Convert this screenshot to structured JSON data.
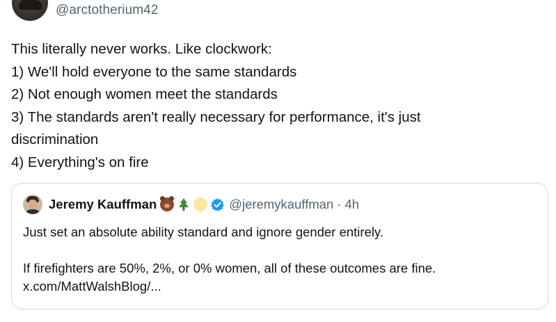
{
  "tweet": {
    "handle": "@arctotherium42",
    "lines": [
      "This literally never works. Like clockwork:",
      "1) We'll hold everyone to the same standards",
      "2) Not enough women meet the standards",
      "3) The standards aren't really necessary for performance, it's just",
      "discrimination",
      "4) Everything's on fire"
    ]
  },
  "quote": {
    "name": "Jeremy Kauffman",
    "badges": [
      "bear-emoji",
      "evergreen-tree-emoji",
      "sun-emoji",
      "verified-badge-icon"
    ],
    "handle": "@jeremykauffman",
    "separator": "·",
    "time": "4h",
    "body": [
      "Just set an absolute ability standard and ignore gender entirely.",
      "",
      "If firefighters are 50%, 2%, or 0% women, all of these outcomes are fine.",
      "x.com/MattWalshBlog/..."
    ]
  },
  "colors": {
    "text": "#0f1419",
    "secondary": "#536471",
    "border": "#cfd9de",
    "verified": "#1d9bf0"
  }
}
